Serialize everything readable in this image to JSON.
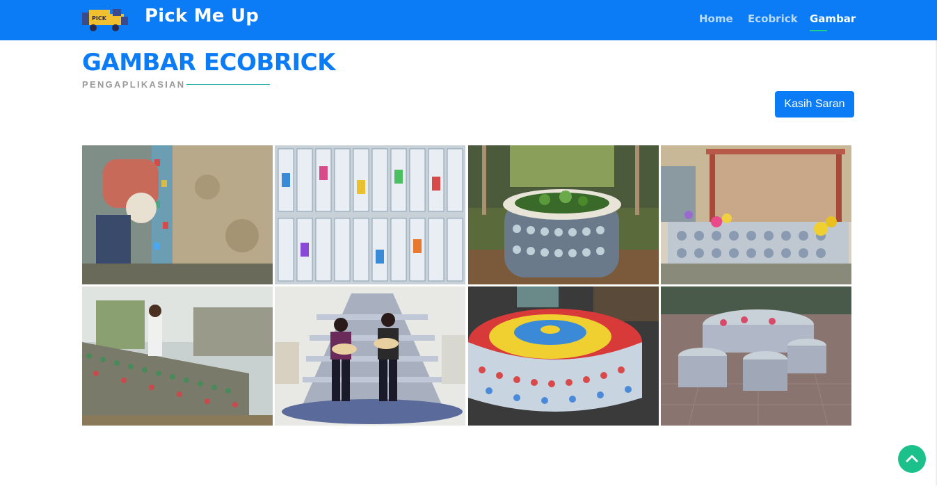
{
  "navbar": {
    "brand": "Pick Me Up",
    "logo_icon": "truck-icon",
    "logo_text": "PICK",
    "items": [
      {
        "label": "Home",
        "active": false
      },
      {
        "label": "Ecobrick",
        "active": false
      },
      {
        "label": "Gambar",
        "active": true
      }
    ],
    "background_color": "#0b7cf5",
    "active_underline_color": "#1bd38b"
  },
  "header": {
    "title": "GAMBAR ECOBRICK",
    "subtitle": "PENGAPLIKASIAN"
  },
  "actions": {
    "suggest_button": "Kasih Saran"
  },
  "gallery": {
    "images": [
      {
        "name": "ecobrick-wall-plastering-photo"
      },
      {
        "name": "stacked-plastic-bottles-photo"
      },
      {
        "name": "bottle-garden-planter-photo"
      },
      {
        "name": "ecobrick-bench-with-flowers-photo"
      },
      {
        "name": "bottle-wall-construction-photo"
      },
      {
        "name": "ecobrick-stage-with-performers-photo"
      },
      {
        "name": "colorful-bottle-cap-table-photo"
      },
      {
        "name": "ecobrick-stools-on-tile-floor-photo"
      }
    ]
  },
  "back_to_top_icon": "chevron-up-icon"
}
